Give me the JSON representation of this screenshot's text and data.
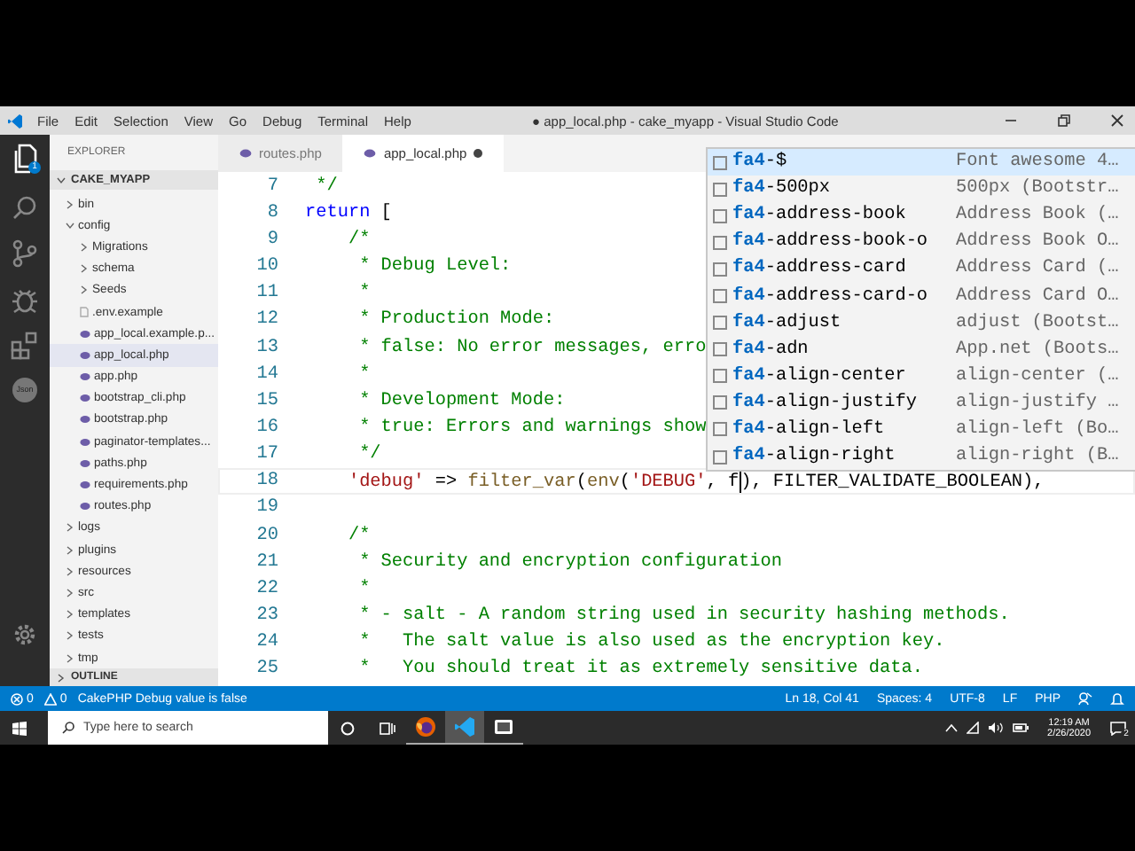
{
  "window": {
    "title": "● app_local.php - cake_myapp - Visual Studio Code",
    "menu": [
      "File",
      "Edit",
      "Selection",
      "View",
      "Go",
      "Debug",
      "Terminal",
      "Help"
    ]
  },
  "activity_bar": {
    "badge": "1",
    "json_label": "Json"
  },
  "sidebar": {
    "title": "EXPLORER",
    "section": "CAKE_MYAPP",
    "outline": "OUTLINE",
    "items": [
      {
        "label": "bin",
        "kind": "folder",
        "expanded": false,
        "selected": false
      },
      {
        "label": "config",
        "kind": "folder",
        "expanded": true,
        "selected": false,
        "children": [
          {
            "label": "Migrations",
            "kind": "folder",
            "expanded": false,
            "selected": false
          },
          {
            "label": "schema",
            "kind": "folder",
            "expanded": false,
            "selected": false
          },
          {
            "label": "Seeds",
            "kind": "folder",
            "expanded": false,
            "selected": false
          },
          {
            "label": ".env.example",
            "kind": "file",
            "selected": false
          },
          {
            "label": "app_local.example.p...",
            "kind": "php",
            "selected": false
          },
          {
            "label": "app_local.php",
            "kind": "php",
            "selected": true
          },
          {
            "label": "app.php",
            "kind": "php",
            "selected": false
          },
          {
            "label": "bootstrap_cli.php",
            "kind": "php",
            "selected": false
          },
          {
            "label": "bootstrap.php",
            "kind": "php",
            "selected": false
          },
          {
            "label": "paginator-templates...",
            "kind": "php",
            "selected": false
          },
          {
            "label": "paths.php",
            "kind": "php",
            "selected": false
          },
          {
            "label": "requirements.php",
            "kind": "php",
            "selected": false
          },
          {
            "label": "routes.php",
            "kind": "php",
            "selected": false
          }
        ]
      },
      {
        "label": "logs",
        "kind": "folder",
        "expanded": false,
        "selected": false
      },
      {
        "label": "plugins",
        "kind": "folder",
        "expanded": false,
        "selected": false
      },
      {
        "label": "resources",
        "kind": "folder",
        "expanded": false,
        "selected": false
      },
      {
        "label": "src",
        "kind": "folder",
        "expanded": false,
        "selected": false
      },
      {
        "label": "templates",
        "kind": "folder",
        "expanded": false,
        "selected": false
      },
      {
        "label": "tests",
        "kind": "folder",
        "expanded": false,
        "selected": false
      },
      {
        "label": "tmp",
        "kind": "folder",
        "expanded": false,
        "selected": false
      }
    ]
  },
  "tabs": [
    {
      "label": "routes.php",
      "selected": false,
      "modified": false
    },
    {
      "label": "app_local.php",
      "selected": true,
      "modified": true
    }
  ],
  "editor": {
    "lines": [
      {
        "number": "7",
        "segments": [
          {
            "kind": "comment",
            "text": " */"
          }
        ]
      },
      {
        "number": "8",
        "segments": [
          {
            "kind": "keyword",
            "text": "return"
          },
          {
            "kind": "plain",
            "text": " ["
          }
        ]
      },
      {
        "number": "9",
        "segments": [
          {
            "kind": "comment",
            "text": "    /*"
          }
        ]
      },
      {
        "number": "10",
        "segments": [
          {
            "kind": "comment",
            "text": "     * Debug Level:"
          }
        ]
      },
      {
        "number": "11",
        "segments": [
          {
            "kind": "comment",
            "text": "     *"
          }
        ]
      },
      {
        "number": "12",
        "segments": [
          {
            "kind": "comment",
            "text": "     * Production Mode:"
          }
        ]
      },
      {
        "number": "13",
        "segments": [
          {
            "kind": "comment",
            "text": "     * false: No error messages, erro"
          }
        ]
      },
      {
        "number": "14",
        "segments": [
          {
            "kind": "comment",
            "text": "     *"
          }
        ]
      },
      {
        "number": "15",
        "segments": [
          {
            "kind": "comment",
            "text": "     * Development Mode:"
          }
        ]
      },
      {
        "number": "16",
        "segments": [
          {
            "kind": "comment",
            "text": "     * true: Errors and warnings show"
          }
        ]
      },
      {
        "number": "17",
        "segments": [
          {
            "kind": "comment",
            "text": "     */"
          }
        ]
      },
      {
        "number": "18",
        "current": true,
        "segments": [
          {
            "kind": "string",
            "text": "    'debug'"
          },
          {
            "kind": "plain",
            "text": " => "
          },
          {
            "kind": "func",
            "text": "filter_var"
          },
          {
            "kind": "plain",
            "text": "("
          },
          {
            "kind": "func",
            "text": "env"
          },
          {
            "kind": "plain",
            "text": "("
          },
          {
            "kind": "string",
            "text": "'DEBUG'"
          },
          {
            "kind": "plain",
            "text": ", f"
          },
          {
            "kind": "cursor"
          },
          {
            "kind": "plain",
            "text": "), FILTER_VALIDATE_BOOLEAN),"
          }
        ]
      },
      {
        "number": "19"
      },
      {
        "number": "20",
        "segments": [
          {
            "kind": "comment",
            "text": "    /*"
          }
        ]
      },
      {
        "number": "21",
        "segments": [
          {
            "kind": "comment",
            "text": "     * Security and encryption configuration"
          }
        ]
      },
      {
        "number": "22",
        "segments": [
          {
            "kind": "comment",
            "text": "     *"
          }
        ]
      },
      {
        "number": "23",
        "segments": [
          {
            "kind": "comment",
            "text": "     * - salt - A random string used in security hashing methods."
          }
        ]
      },
      {
        "number": "24",
        "segments": [
          {
            "kind": "comment",
            "text": "     *   The salt value is also used as the encryption key."
          }
        ]
      },
      {
        "number": "25",
        "segments": [
          {
            "kind": "comment",
            "text": "     *   You should treat it as extremely sensitive data."
          }
        ]
      }
    ]
  },
  "suggestions": [
    {
      "label": "**fa4**-$",
      "detail": "Font awesome 4…",
      "selected": true
    },
    {
      "label": "**fa4**-500px",
      "detail": "500px (Bootstr…",
      "selected": false
    },
    {
      "label": "**fa4**-address-book",
      "detail": "Address Book (…",
      "selected": false
    },
    {
      "label": "**fa4**-address-book-o",
      "detail": "Address Book O…",
      "selected": false
    },
    {
      "label": "**fa4**-address-card",
      "detail": "Address Card (…",
      "selected": false
    },
    {
      "label": "**fa4**-address-card-o",
      "detail": "Address Card O…",
      "selected": false
    },
    {
      "label": "**fa4**-adjust",
      "detail": "adjust (Bootst…",
      "selected": false
    },
    {
      "label": "**fa4**-adn",
      "detail": "App.net (Boots…",
      "selected": false
    },
    {
      "label": "**fa4**-align-center",
      "detail": "align-center (…",
      "selected": false
    },
    {
      "label": "**fa4**-align-justify",
      "detail": "align-justify …",
      "selected": false
    },
    {
      "label": "**fa4**-align-left",
      "detail": "align-left (Bo…",
      "selected": false
    },
    {
      "label": "**fa4**-align-right",
      "detail": "align-right (B…",
      "selected": false
    }
  ],
  "status_bar": {
    "errors": "0",
    "warnings": "0",
    "message": "CakePHP Debug value is false",
    "items": [
      "Ln 18, Col 41",
      "Spaces: 4",
      "UTF-8",
      "LF",
      "PHP"
    ]
  },
  "taskbar": {
    "search_placeholder": "Type here to search",
    "apps": [
      {
        "kind": "firefox",
        "selected": false
      },
      {
        "kind": "vscode",
        "selected": true
      },
      {
        "kind": "media",
        "selected": false
      }
    ],
    "time": "12:19 AM",
    "date": "2/26/2020",
    "notifications": "2"
  }
}
